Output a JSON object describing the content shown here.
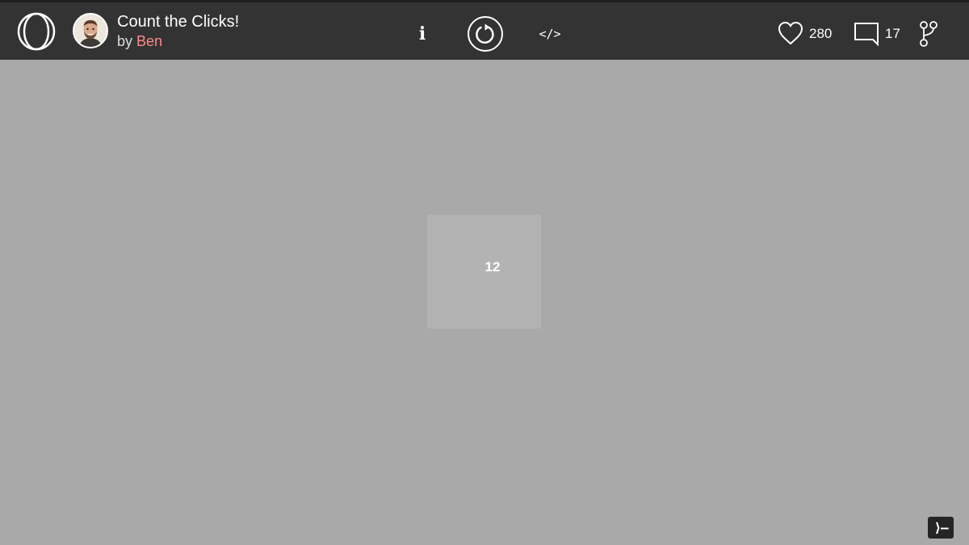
{
  "header": {
    "logo_icon": "openprocessing-logo-icon",
    "avatar_icon": "user-avatar-icon",
    "title": "Count the Clicks!",
    "by_prefix": "by ",
    "author": "Ben",
    "author_color": "#ff8a8a"
  },
  "toolbar": {
    "info_label": "i",
    "info_icon": "info-icon",
    "restart_icon": "restart-icon",
    "code_label": "</>",
    "code_icon": "code-icon"
  },
  "stats": {
    "likes_icon": "heart-icon",
    "likes": "280",
    "comments_icon": "comment-icon",
    "comments": "17",
    "fork_icon": "fork-icon"
  },
  "sketch": {
    "click_count": "12",
    "background_color": "#a9a9a9",
    "box_color": "#b3b3b3"
  },
  "console": {
    "label": "⟩—",
    "icon": "console-icon"
  },
  "colors": {
    "topbar": "#333333",
    "text": "#ffffff"
  }
}
